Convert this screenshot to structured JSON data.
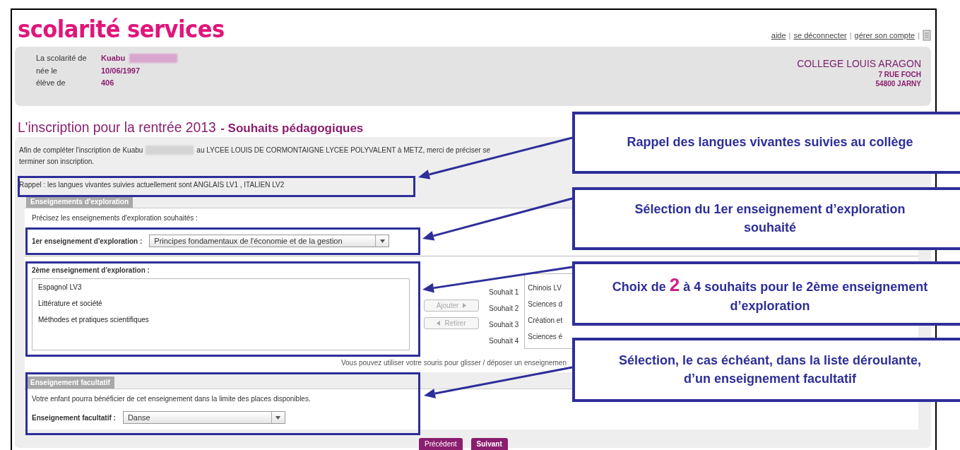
{
  "header": {
    "logo": "scolarité services",
    "links": [
      "aide",
      "se déconnecter",
      "gérer son compte"
    ],
    "separator": "|"
  },
  "student": {
    "rows": [
      {
        "label": "La scolarité de",
        "value": "Kuabu",
        "redacted": true
      },
      {
        "label": "née le",
        "value": "10/06/1997",
        "redacted": false
      },
      {
        "label": "élève de",
        "value": "406",
        "redacted": false
      }
    ],
    "school": {
      "name": "COLLEGE LOUIS ARAGON",
      "address": [
        "7 RUE FOCH",
        "54800 JARNY"
      ]
    }
  },
  "page_title": {
    "main": "L'inscription pour la rentrée 2013",
    "sub": "- Souhaits pédagogiques"
  },
  "intro": {
    "before": "Afin de compléter l'inscription de Kuabu",
    "after": "au LYCEE LOUIS DE CORMONTAIGNE LYCEE POLYVALENT à METZ, merci de préciser se",
    "second_line": "terminer son inscription."
  },
  "rappel": "Rappel : les langues vivantes suivies actuellement sont ANGLAIS LV1 , ITALIEN LV2",
  "exploration": {
    "tab": "Enseignements d'exploration",
    "prompt": "Précisez les enseignements d'exploration souhaités :",
    "first": {
      "label": "1er enseignement d'exploration :",
      "value": "Principes fondamentaux de l'économie et de la gestion"
    },
    "second_label": "2ème enseignement d'exploration :",
    "available": [
      "Espagnol LV3",
      "Littérature et société",
      "Méthodes et pratiques scientifiques"
    ],
    "actions": [
      {
        "label": "Ajouter",
        "kind": "add",
        "disabled": true
      },
      {
        "label": "Retirer",
        "kind": "remove",
        "disabled": true
      }
    ],
    "wishes": [
      {
        "label": "Souhait 1",
        "value": "Chinois LV"
      },
      {
        "label": "Souhait 2",
        "value": "Sciences d"
      },
      {
        "label": "Souhait 3",
        "value": "Création et"
      },
      {
        "label": "Souhait 4",
        "value": "Sciences é"
      }
    ],
    "hint": "Vous pouvez utiliser votre souris pour glisser / déposer un enseignemen"
  },
  "facultatif": {
    "tab": "Enseignement facultatif",
    "text": "Votre enfant pourra bénéficier de cet enseignement dans la limite des places disponibles.",
    "label": "Enseignement facultatif :",
    "value": "Danse"
  },
  "buttons": [
    "Précédent",
    "Suivant"
  ],
  "annotations": [
    {
      "segments": [
        {
          "text": "Rappel des langues vivantes suivies au collège",
          "emphasis": false
        }
      ]
    },
    {
      "segments": [
        {
          "text": "Sélection du 1er enseignement d’exploration souhaité",
          "emphasis": false
        }
      ]
    },
    {
      "segments": [
        {
          "text": "Choix de ",
          "emphasis": false
        },
        {
          "text": "2",
          "emphasis": true
        },
        {
          "text": " à 4 souhaits pour le 2ème enseignement d’exploration",
          "emphasis": false
        }
      ]
    },
    {
      "segments": [
        {
          "text": "Sélection, le cas échéant, dans la liste déroulante, d’un enseignement facultatif",
          "emphasis": false
        }
      ]
    }
  ]
}
